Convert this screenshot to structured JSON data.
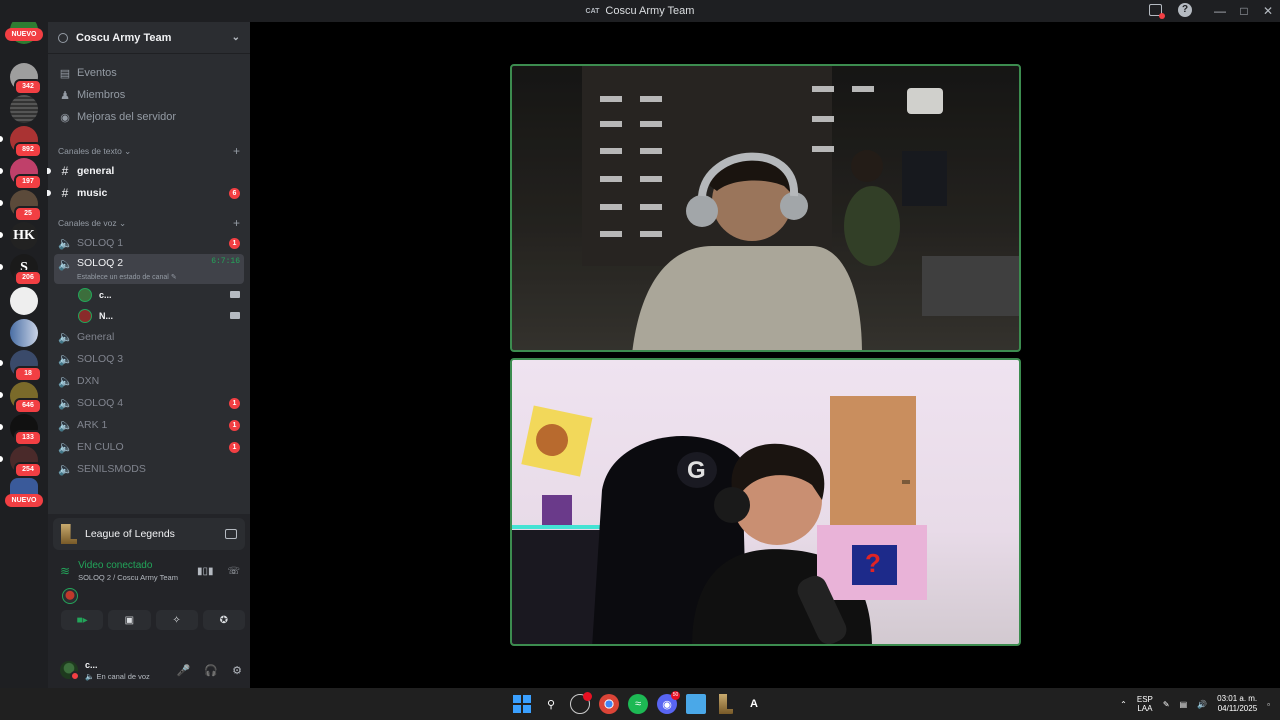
{
  "window": {
    "title": "Coscu Army Team",
    "tag": "CAT"
  },
  "rail": {
    "badges": [
      "342",
      "892",
      "197",
      "25",
      "206",
      "18",
      "646",
      "133",
      "254"
    ],
    "new_label_top": "NUEVO",
    "new_label_bottom": "NUEVO",
    "hk_label": "HK",
    "s_label": "S"
  },
  "guild": {
    "name": "Coscu Army Team"
  },
  "nav": [
    {
      "label": "Eventos",
      "icon": "calendar-icon"
    },
    {
      "label": "Miembros",
      "icon": "members-icon"
    },
    {
      "label": "Mejoras del servidor",
      "icon": "boost-icon"
    }
  ],
  "text_category": {
    "label": "Canales de texto"
  },
  "text_channels": [
    {
      "name": "general",
      "unread": true,
      "count": ""
    },
    {
      "name": "music",
      "unread": true,
      "count": "6"
    }
  ],
  "voice_category": {
    "label": "Canales de voz"
  },
  "voice_channels": [
    {
      "name": "SOLOQ 1",
      "count": "1"
    },
    {
      "name": "SOLOQ 2",
      "active": true,
      "timer": "6:7:16",
      "status": "Establece un estado de canal"
    },
    {
      "name": "General",
      "count": ""
    },
    {
      "name": "SOLOQ 3",
      "count": ""
    },
    {
      "name": "DXN",
      "count": ""
    },
    {
      "name": "SOLOQ 4",
      "count": "1"
    },
    {
      "name": "ARK 1",
      "count": "1"
    },
    {
      "name": "EN CULO",
      "count": "1"
    },
    {
      "name": "SENILSMODS",
      "count": ""
    }
  ],
  "voice_users": [
    {
      "name": "c..."
    },
    {
      "name": "N..."
    }
  ],
  "activity": {
    "title": "League of Legends"
  },
  "connection": {
    "status": "Video conectado",
    "location": "SOLOQ 2 / Coscu Army Team"
  },
  "user": {
    "name": "c...",
    "status": "En canal de voz"
  },
  "taskbar": {
    "lang_top": "ESP",
    "lang_bottom": "LAA",
    "time": "03:01 a. m.",
    "date": "04/11/2025",
    "discord_badge": "50"
  },
  "colors": {
    "accent_green": "#23a55a",
    "badge_red": "#f23f43",
    "tile_border": "#3c8c4f"
  }
}
